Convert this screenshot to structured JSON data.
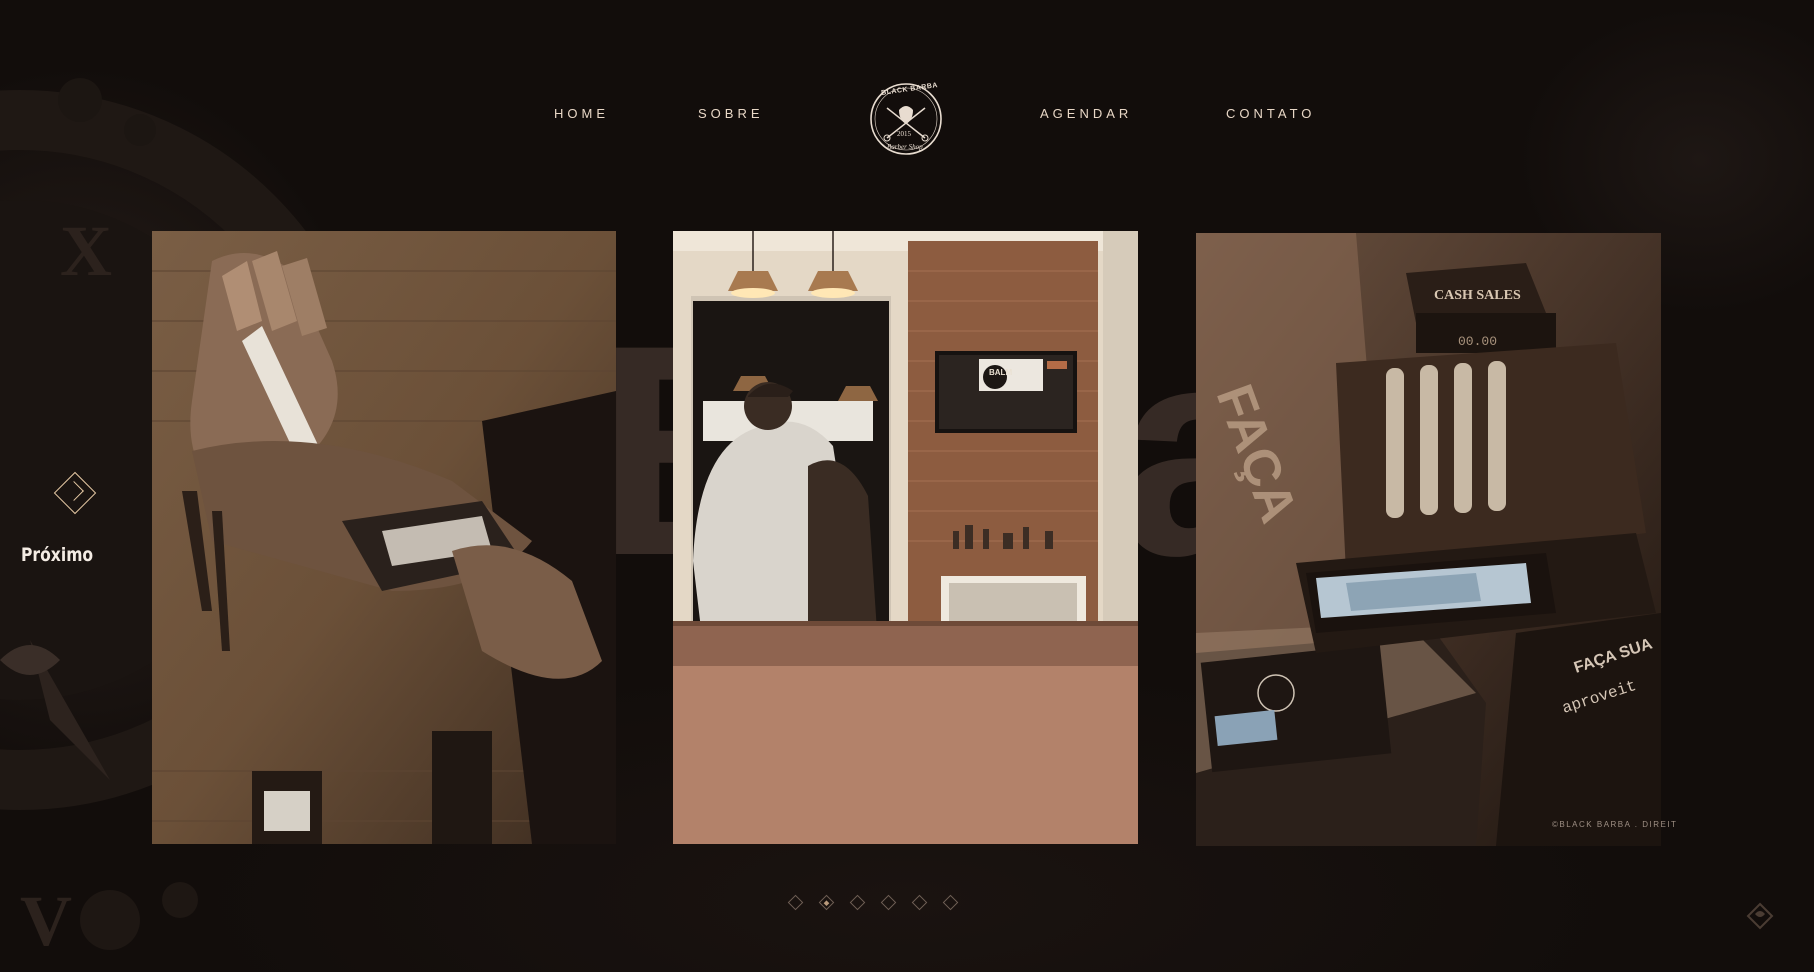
{
  "nav": {
    "items": [
      {
        "label": "HOME"
      },
      {
        "label": "SOBRE"
      },
      {
        "label": "AGENDAR"
      },
      {
        "label": "CONTATO"
      }
    ],
    "logo": {
      "brand": "BLACK BARBA",
      "year": "2015",
      "tagline": "Barber Shop"
    }
  },
  "slider": {
    "next_label": "Próximo",
    "copyright": "©BLACK BARBA . DIREIT",
    "slides": [
      {
        "name": "trimmer-oil-photo"
      },
      {
        "name": "barbershop-interior-photo"
      },
      {
        "name": "cash-register-photo"
      }
    ],
    "pagination": {
      "count": 6,
      "active_index": 1
    },
    "photo_text": {
      "tv_label": "BALM",
      "register_sign": "CASH SALES",
      "register_amount": "00.00",
      "card_line1": "FAÇA SUA",
      "card_line2": "aproveit"
    }
  },
  "colors": {
    "background": "#120d0b",
    "nav_text": "#e8d7c6",
    "accent": "#e6c9a4"
  }
}
